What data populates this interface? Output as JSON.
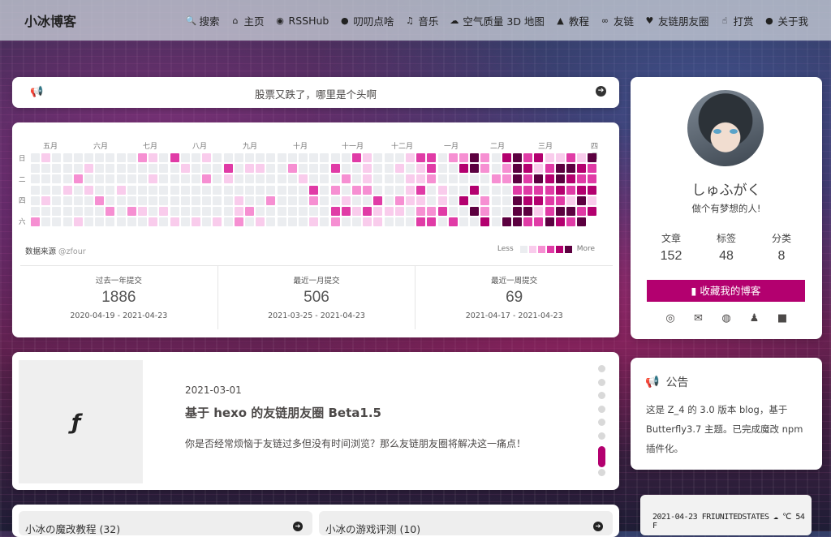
{
  "site": {
    "name": "小冰博客"
  },
  "menu": [
    {
      "icon": "search-icon",
      "glyph": "🔍",
      "label": "搜索"
    },
    {
      "icon": "home-icon",
      "glyph": "⌂",
      "label": "主页"
    },
    {
      "icon": "rss-icon",
      "glyph": "◉",
      "label": "RSSHub"
    },
    {
      "icon": "comment-icon",
      "glyph": "●",
      "label": "叨叨点啥"
    },
    {
      "icon": "music-icon",
      "glyph": "♫",
      "label": "音乐"
    },
    {
      "icon": "cloud-icon",
      "glyph": "☁",
      "label": "空气质量 3D 地图"
    },
    {
      "icon": "graduation-cap-icon",
      "glyph": "▲",
      "label": "教程"
    },
    {
      "icon": "link-icon",
      "glyph": "∞",
      "label": "友链"
    },
    {
      "icon": "heartbeat-icon",
      "glyph": "♥",
      "label": "友链朋友圈"
    },
    {
      "icon": "thumbs-up-icon",
      "glyph": "☝",
      "label": "打赏"
    },
    {
      "icon": "lightbulb-icon",
      "glyph": "●",
      "label": "关于我"
    }
  ],
  "notice": {
    "text": "股票又跌了，哪里是个头啊"
  },
  "calendar": {
    "months": [
      "五月",
      "六月",
      "七月",
      "八月",
      "九月",
      "十月",
      "十一月",
      "十二月",
      "一月",
      "二月",
      "三月",
      "四月"
    ],
    "days": [
      "日",
      "二",
      "四",
      "六"
    ],
    "source_label": "数据来源",
    "source_user": "@zfour",
    "legend_less": "Less",
    "legend_more": "More",
    "colors": [
      "#ebedf0",
      "#f9ccec",
      "#f68fd2",
      "#e03ba6",
      "#b3006f",
      "#5c0040"
    ],
    "stats": [
      {
        "label": "过去一年提交",
        "value": "1886",
        "range": "2020-04-19 - 2021-04-23"
      },
      {
        "label": "最近一月提交",
        "value": "506",
        "range": "2021-03-25 - 2021-04-23"
      },
      {
        "label": "最近一周提交",
        "value": "69",
        "range": "2021-04-17 - 2021-04-23"
      }
    ]
  },
  "article": {
    "date": "2021-03-01",
    "title": "基于 hexo 的友链朋友圈 Beta1.5",
    "desc": "你是否经常烦恼于友链过多但没有时间浏览？那么友链朋友圈将解决这一痛点！",
    "thumb_logo": "ƒ"
  },
  "categories": [
    {
      "icon": "book-icon",
      "label": "小冰の魔改教程 (32)"
    },
    {
      "icon": "gamepad-icon",
      "label": "小冰の游戏评测 (10)"
    }
  ],
  "profile": {
    "author": "しゅふがく",
    "desc": "做个有梦想的人!",
    "stats": [
      {
        "label": "文章",
        "value": "152"
      },
      {
        "label": "标签",
        "value": "48"
      },
      {
        "label": "分类",
        "value": "8"
      }
    ],
    "follow_label": "收藏我的博客",
    "social": [
      {
        "icon": "github-icon",
        "glyph": "◎"
      },
      {
        "icon": "email-icon",
        "glyph": "✉"
      },
      {
        "icon": "weibo-icon",
        "glyph": "◍"
      },
      {
        "icon": "qq-icon",
        "glyph": "♟"
      },
      {
        "icon": "video-icon",
        "glyph": "■"
      }
    ]
  },
  "announcement": {
    "title": "公告",
    "body": "这是 Z_4 的 3.0 版本 blog，基于 Butterfly3.7 主题。已完成魔改 npm 插件化。"
  },
  "weather": {
    "text": "2021-04-23 FRIUNITEDSTATES ☁ ℃ 54 F"
  }
}
